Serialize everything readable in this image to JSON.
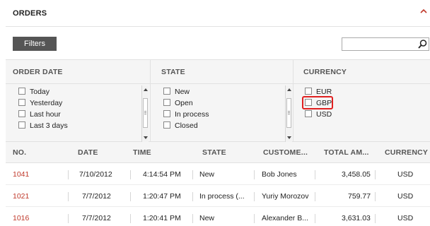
{
  "panel": {
    "title": "ORDERS",
    "collapse_icon": "chevron-up-icon",
    "accent_color": "#c0392b"
  },
  "toolbar": {
    "filters_label": "Filters",
    "search_value": "",
    "search_icon": "search-icon"
  },
  "filters": {
    "order_date": {
      "heading": "ORDER DATE",
      "options": [
        {
          "label": "Today",
          "checked": false
        },
        {
          "label": "Yesterday",
          "checked": false
        },
        {
          "label": "Last hour",
          "checked": false
        },
        {
          "label": "Last 3 days",
          "checked": false
        }
      ]
    },
    "state": {
      "heading": "STATE",
      "options": [
        {
          "label": "New",
          "checked": false
        },
        {
          "label": "Open",
          "checked": false
        },
        {
          "label": "In process",
          "checked": false
        },
        {
          "label": "Closed",
          "checked": false
        }
      ]
    },
    "currency": {
      "heading": "CURRENCY",
      "options": [
        {
          "label": "EUR",
          "checked": false
        },
        {
          "label": "GBP",
          "checked": false,
          "highlighted": true
        },
        {
          "label": "USD",
          "checked": false
        }
      ]
    }
  },
  "table": {
    "columns": [
      "NO.",
      "DATE",
      "TIME",
      "STATE",
      "CUSTOME...",
      "TOTAL AM...",
      "CURRENCY"
    ],
    "rows": [
      {
        "no": "1041",
        "date": "7/10/2012",
        "time": "4:14:54 PM",
        "state": "New",
        "customer": "Bob Jones",
        "total": "3,458.05",
        "currency": "USD"
      },
      {
        "no": "1021",
        "date": "7/7/2012",
        "time": "1:20:47 PM",
        "state": "In process (...",
        "customer": "Yuriy Morozov",
        "total": "759.77",
        "currency": "USD"
      },
      {
        "no": "1016",
        "date": "7/7/2012",
        "time": "1:20:41 PM",
        "state": "New",
        "customer": "Alexander B...",
        "total": "3,631.03",
        "currency": "USD"
      }
    ]
  }
}
